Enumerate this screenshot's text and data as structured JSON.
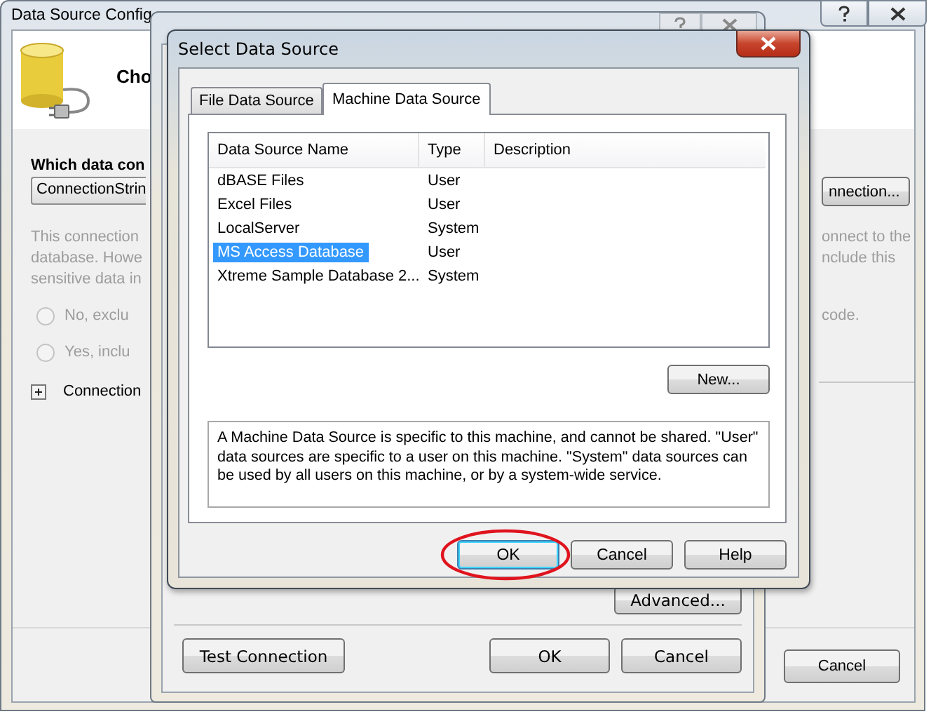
{
  "wizard": {
    "title": "Data Source Config",
    "heading": "Cho",
    "question": "Which data con",
    "connection_combo": {
      "value": "ConnectionStrin"
    },
    "new_connection_button": "nnection...",
    "note_left": [
      "This connection",
      "database. Howe",
      "sensitive data in"
    ],
    "note_right": [
      "onnect to the",
      "nclude this"
    ],
    "options": [
      {
        "label": "No, exclu",
        "selected": false,
        "disabled": true
      },
      {
        "label": "Yes, inclu",
        "selected": false,
        "disabled": true
      }
    ],
    "option_right": "code.",
    "expander": {
      "label": "Connection",
      "expanded": false
    },
    "cancel_button": "Cancel"
  },
  "add_connection": {
    "advanced_button": "Advanced...",
    "test_button": "Test Connection",
    "ok_button": "OK",
    "cancel_button": "Cancel"
  },
  "dialog": {
    "title": "Select Data Source",
    "tabs": [
      {
        "label": "File Data Source",
        "selected": false
      },
      {
        "label": "Machine Data Source",
        "selected": true
      }
    ],
    "list": {
      "columns": [
        "Data Source Name",
        "Type",
        "Description"
      ],
      "rows": [
        {
          "name": "dBASE Files",
          "type": "User",
          "selected": false
        },
        {
          "name": "Excel Files",
          "type": "User",
          "selected": false
        },
        {
          "name": "LocalServer",
          "type": "System",
          "selected": false
        },
        {
          "name": "MS Access Database",
          "type": "User",
          "selected": true
        },
        {
          "name": "Xtreme Sample Database 2...",
          "type": "System",
          "selected": false
        }
      ]
    },
    "new_button": "New...",
    "description": "A Machine Data Source is specific to this machine, and cannot be shared. \"User\" data sources are specific to a user on this machine.  \"System\" data sources can be used by all users on this machine, or by a system-wide service.",
    "buttons": [
      {
        "label": "OK",
        "default": true
      },
      {
        "label": "Cancel",
        "default": false
      },
      {
        "label": "Help",
        "default": false
      }
    ]
  }
}
